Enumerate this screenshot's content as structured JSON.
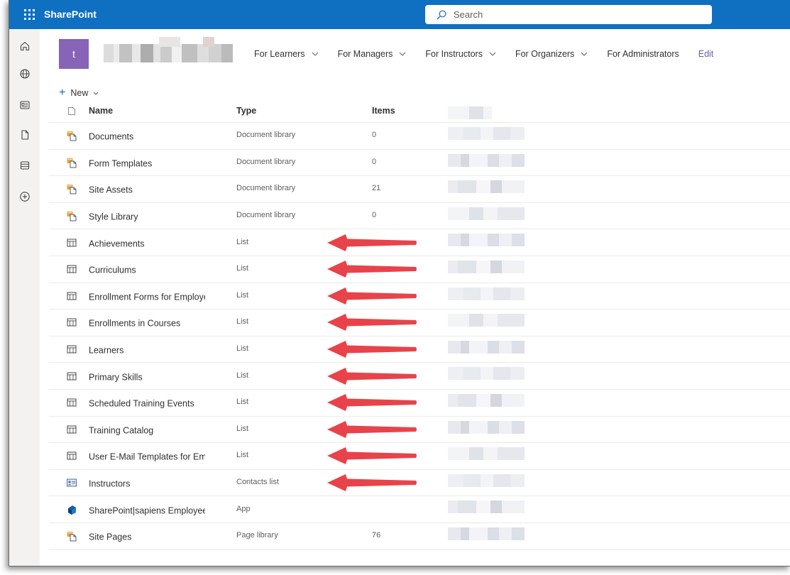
{
  "topbar": {
    "app_name": "SharePoint",
    "search_placeholder": "Search",
    "bg_color": "#0f70c2"
  },
  "rail": {
    "icons": [
      "home-icon",
      "globe-icon",
      "news-icon",
      "document-icon",
      "list-icon",
      "add-circle-icon"
    ]
  },
  "site": {
    "logo_letter": "t",
    "logo_color": "#8764b8"
  },
  "nav": {
    "items": [
      "For Learners",
      "For Managers",
      "For Instructors",
      "For Organizers",
      "For Administrators"
    ],
    "edit_label": "Edit"
  },
  "command_bar": {
    "new_label": "New"
  },
  "table": {
    "columns": [
      "Name",
      "Type",
      "Items"
    ],
    "rows": [
      {
        "name": "Documents",
        "type": "Document library",
        "items": "0",
        "icon": "document-library-icon",
        "arrow": false
      },
      {
        "name": "Form Templates",
        "type": "Document library",
        "items": "0",
        "icon": "document-library-icon",
        "arrow": false
      },
      {
        "name": "Site Assets",
        "type": "Document library",
        "items": "21",
        "icon": "document-library-icon",
        "arrow": false
      },
      {
        "name": "Style Library",
        "type": "Document library",
        "items": "0",
        "icon": "document-library-icon",
        "arrow": false
      },
      {
        "name": "Achievements",
        "type": "List",
        "items": "",
        "icon": "list-icon",
        "arrow": true
      },
      {
        "name": "Curriculums",
        "type": "List",
        "items": "",
        "icon": "list-icon",
        "arrow": true
      },
      {
        "name": "Enrollment Forms for Employe",
        "type": "List",
        "items": "",
        "icon": "list-icon",
        "arrow": true
      },
      {
        "name": "Enrollments in Courses",
        "type": "List",
        "items": "",
        "icon": "list-icon",
        "arrow": true
      },
      {
        "name": "Learners",
        "type": "List",
        "items": "",
        "icon": "list-icon",
        "arrow": true
      },
      {
        "name": "Primary Skills",
        "type": "List",
        "items": "",
        "icon": "list-icon",
        "arrow": true
      },
      {
        "name": "Scheduled Training Events",
        "type": "List",
        "items": "",
        "icon": "list-icon",
        "arrow": true
      },
      {
        "name": "Training Catalog",
        "type": "List",
        "items": "",
        "icon": "list-icon",
        "arrow": true
      },
      {
        "name": "User E-Mail Templates for Em|",
        "type": "List",
        "items": "",
        "icon": "list-icon",
        "arrow": true
      },
      {
        "name": "Instructors",
        "type": "Contacts list",
        "items": "",
        "icon": "contacts-list-icon",
        "arrow": true
      },
      {
        "name": "SharePoint|sapiens Employee",
        "type": "App",
        "items": "",
        "icon": "app-icon",
        "arrow": false
      },
      {
        "name": "Site Pages",
        "type": "Page library",
        "items": "76",
        "icon": "document-library-icon",
        "arrow": false
      }
    ]
  },
  "annotation_color": "#e8434a"
}
